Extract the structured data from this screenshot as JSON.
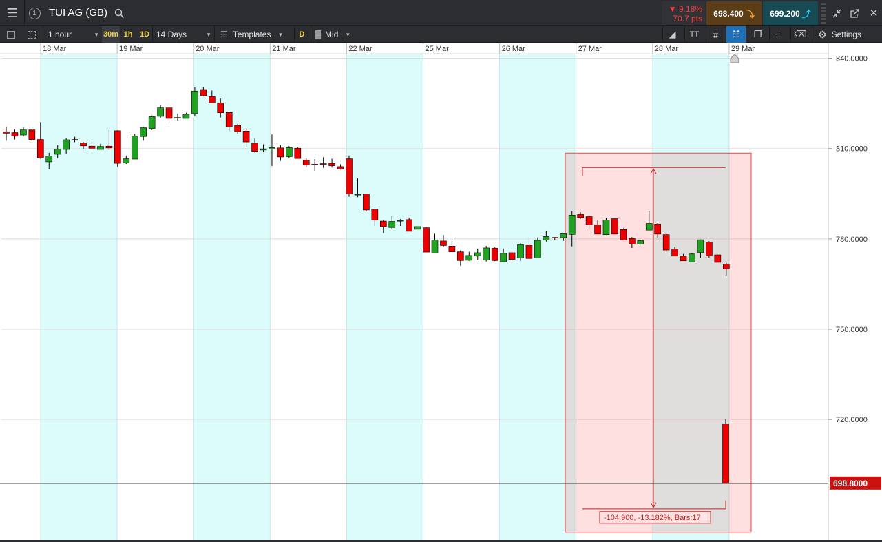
{
  "header": {
    "instrument": "TUI AG (GB)",
    "step_label": "1",
    "change_pct": "▼ 9.18%",
    "change_pts": "70.7 pts",
    "sell_price": "698.400",
    "buy_price": "699.200"
  },
  "toolbar": {
    "interval": "1 hour",
    "quick_30m": "30m",
    "quick_1h": "1h",
    "quick_1d": "1D",
    "range": "14 Days",
    "templates": "Templates",
    "d_badge": "D",
    "price_type": "Mid",
    "text_tool": "TT",
    "settings": "Settings"
  },
  "chart_data": {
    "type": "candlestick",
    "interval": "1 hour",
    "categories": [
      "18 Mar",
      "19 Mar",
      "20 Mar",
      "21 Mar",
      "22 Mar",
      "25 Mar",
      "26 Mar",
      "27 Mar",
      "28 Mar",
      "29 Mar"
    ],
    "price_ticks": [
      "840.0000",
      "810.0000",
      "780.0000",
      "750.0000",
      "720.0000"
    ],
    "tick_values": [
      840,
      810,
      780,
      750,
      720
    ],
    "ylim": [
      680,
      841.5
    ],
    "current_price_label": "698.8000",
    "current_price": 698.8,
    "measure": {
      "label": "-104.900, -13.182%, Bars:17",
      "start_price": 803.7,
      "end_price": 698.8
    },
    "candles": [
      [
        815.6,
        815.1,
        817.3,
        812.6
      ],
      [
        815.3,
        814.1,
        816.3,
        813.0
      ],
      [
        814.5,
        816.2,
        817.0,
        814.0
      ],
      [
        816.2,
        813.0,
        816.6,
        812.5
      ],
      [
        813.0,
        806.9,
        818.8,
        806.6
      ],
      [
        805.6,
        807.5,
        808.6,
        803.1
      ],
      [
        808.1,
        809.8,
        811.1,
        806.8
      ],
      [
        809.7,
        812.9,
        813.4,
        808.2
      ],
      [
        813.0,
        812.8,
        813.9,
        812.1
      ],
      [
        811.9,
        810.9,
        812.2,
        809.7
      ],
      [
        810.8,
        810.1,
        812.3,
        809.1
      ],
      [
        809.7,
        810.7,
        811.6,
        809.8
      ],
      [
        810.8,
        810.2,
        816.2,
        809.5
      ],
      [
        815.9,
        805.1,
        816.1,
        803.9
      ],
      [
        805.2,
        806.6,
        807.7,
        804.9
      ],
      [
        806.5,
        814.2,
        814.9,
        806.6
      ],
      [
        814.0,
        816.9,
        817.3,
        812.6
      ],
      [
        816.6,
        820.6,
        821.0,
        816.2
      ],
      [
        820.7,
        823.5,
        824.4,
        820.2
      ],
      [
        823.5,
        820.0,
        824.6,
        818.4
      ],
      [
        820.1,
        820.3,
        821.6,
        819.3
      ],
      [
        820.0,
        821.4,
        821.9,
        820.3
      ],
      [
        821.6,
        829.1,
        830.3,
        820.7
      ],
      [
        829.6,
        827.5,
        830.4,
        827.3
      ],
      [
        827.3,
        825.2,
        829.3,
        825.3
      ],
      [
        825.2,
        821.9,
        826.6,
        820.3
      ],
      [
        822.0,
        817.2,
        822.3,
        815.8
      ],
      [
        817.7,
        815.6,
        818.2,
        814.9
      ],
      [
        815.8,
        812.2,
        816.6,
        810.4
      ],
      [
        811.8,
        809.1,
        813.3,
        808.7
      ],
      [
        809.5,
        809.9,
        811.4,
        808.9
      ],
      [
        809.8,
        810.3,
        814.7,
        804.2
      ],
      [
        810.2,
        807.2,
        811.1,
        805.9
      ],
      [
        807.3,
        810.3,
        810.8,
        806.8
      ],
      [
        810.1,
        806.7,
        810.5,
        806.8
      ],
      [
        806.2,
        804.5,
        806.8,
        803.8
      ],
      [
        804.8,
        804.6,
        806.5,
        802.6
      ],
      [
        805.0,
        804.9,
        807.1,
        803.6
      ],
      [
        805.1,
        804.3,
        806.6,
        803.7
      ],
      [
        804.0,
        803.2,
        804.8,
        803.0
      ],
      [
        806.6,
        794.9,
        807.7,
        794.0
      ],
      [
        794.8,
        794.8,
        800.1,
        793.9
      ],
      [
        794.9,
        789.6,
        795.0,
        789.1
      ],
      [
        789.9,
        786.2,
        789.9,
        784.3
      ],
      [
        785.9,
        784.1,
        786.2,
        781.9
      ],
      [
        783.8,
        785.8,
        787.5,
        783.4
      ],
      [
        785.9,
        786.1,
        786.6,
        784.3
      ],
      [
        786.4,
        782.5,
        787.0,
        782.7
      ],
      [
        783.2,
        784.1,
        783.9,
        783.3
      ],
      [
        783.7,
        775.6,
        783.9,
        775.8
      ],
      [
        775.3,
        779.6,
        781.7,
        775.4
      ],
      [
        779.3,
        777.8,
        781.3,
        777.3
      ],
      [
        777.6,
        775.7,
        779.3,
        776.0
      ],
      [
        775.7,
        772.8,
        776.2,
        771.1
      ],
      [
        772.9,
        774.5,
        775.7,
        772.7
      ],
      [
        774.3,
        775.4,
        776.8,
        773.1
      ],
      [
        773.0,
        777.0,
        777.7,
        772.5
      ],
      [
        776.9,
        772.8,
        777.2,
        772.6
      ],
      [
        772.4,
        775.2,
        776.8,
        772.5
      ],
      [
        775.4,
        773.2,
        775.3,
        772.5
      ],
      [
        773.7,
        778.1,
        778.5,
        772.7
      ],
      [
        777.8,
        773.5,
        780.6,
        773.5
      ],
      [
        773.7,
        779.5,
        780.5,
        779.5
      ],
      [
        779.6,
        780.8,
        782.5,
        779.1
      ],
      [
        780.5,
        780.4,
        780.6,
        779.5
      ],
      [
        780.4,
        781.7,
        781.8,
        779.3
      ],
      [
        781.5,
        787.9,
        789.2,
        777.5
      ],
      [
        788.1,
        787.1,
        788.8,
        786.7
      ],
      [
        787.4,
        784.7,
        787.3,
        783.2
      ],
      [
        784.6,
        781.6,
        786.1,
        783.0
      ],
      [
        781.4,
        786.3,
        786.9,
        781.3
      ],
      [
        786.7,
        781.6,
        786.8,
        781.5
      ],
      [
        783.1,
        779.6,
        783.5,
        779.6
      ],
      [
        780.1,
        778.3,
        780.6,
        777.0
      ],
      [
        778.3,
        779.4,
        779.6,
        778.4
      ],
      [
        782.9,
        785.1,
        789.3,
        783.1
      ],
      [
        784.9,
        781.6,
        785.2,
        780.4
      ],
      [
        781.4,
        776.3,
        781.8,
        775.7
      ],
      [
        776.6,
        774.3,
        777.3,
        774.4
      ],
      [
        774.3,
        772.7,
        775.0,
        772.9
      ],
      [
        772.3,
        775.0,
        775.2,
        773.4
      ],
      [
        775.4,
        779.7,
        779.8,
        773.7
      ],
      [
        778.9,
        774.4,
        779.2,
        773.8
      ],
      [
        774.7,
        772.2,
        774.6,
        772.4
      ],
      [
        771.6,
        770.0,
        772.1,
        767.7
      ],
      [
        718.5,
        698.8,
        720.0,
        698.8
      ]
    ]
  }
}
